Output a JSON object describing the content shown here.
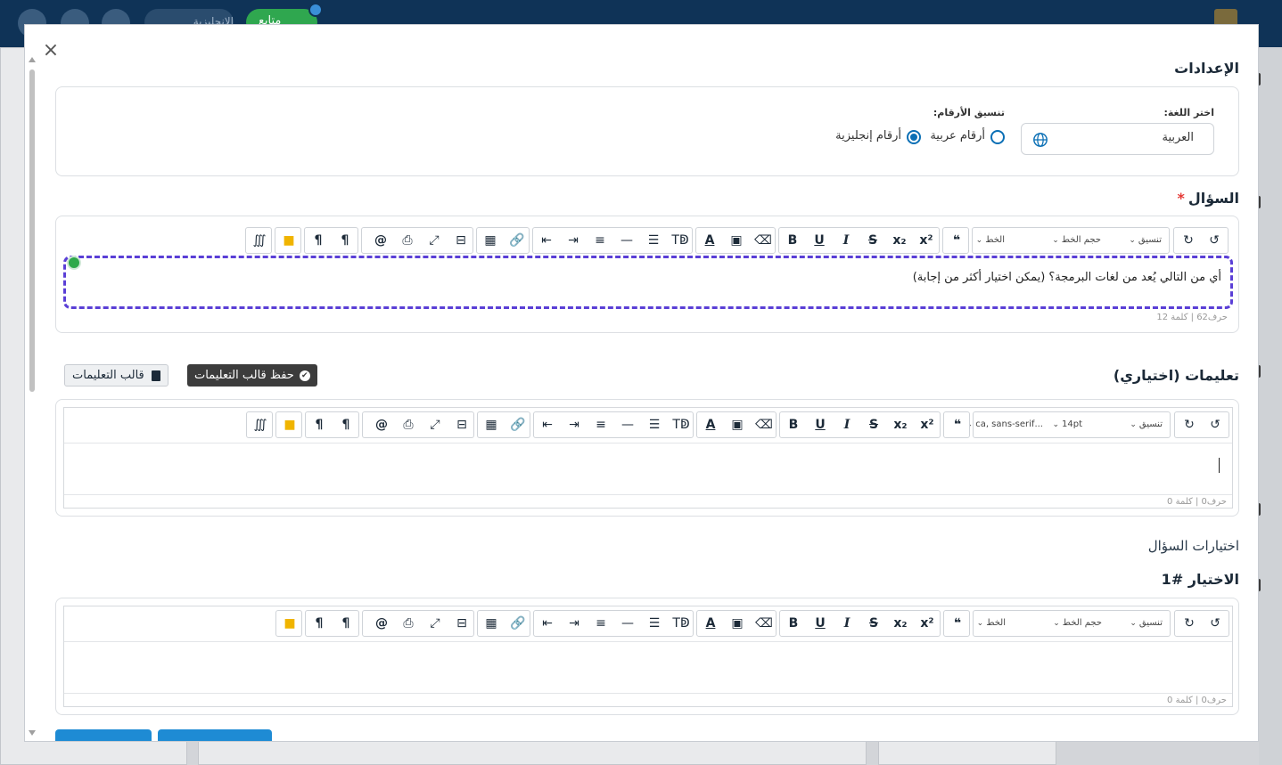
{
  "topbar": {
    "language_pill": "الإنجليزية",
    "status_pill": "متابع"
  },
  "modal": {
    "close_label": "×",
    "settings_title": "الإعدادات",
    "language": {
      "label": "اختر اللغة:",
      "value": "العربية",
      "icon": "globe-icon"
    },
    "number_format": {
      "label": "تنسيق الأرقام:",
      "options": [
        {
          "label": "أرقام عربية",
          "checked": false
        },
        {
          "label": "أرقام إنجليزية",
          "checked": true
        }
      ]
    },
    "question": {
      "title": "السؤال",
      "required_mark": "*",
      "text": "أي من التالي يُعد من لغات البرمجة؟ (يمكن اختيار أكثر من إجابة)",
      "status": "حرف62   |   كلمة 12",
      "toolbar": {
        "format": "تنسيق",
        "font_size": "حجم الخط",
        "font": "الخط"
      }
    },
    "instructions": {
      "title": "تعليمات (اختياري)",
      "save_template_label": "حفظ قالب التعليمات",
      "template_label": "قالب التعليمات",
      "status": "حرف0   |   كلمة 0",
      "toolbar": {
        "format": "تنسيق",
        "font_size": "14pt",
        "font": "...ca, sans-serif"
      }
    },
    "choices": {
      "title": "اختيارات السؤال",
      "choice1_title": "الاختيار #1",
      "status": "حرف0   |   كلمة 0",
      "toolbar": {
        "format": "تنسيق",
        "font_size": "حجم الخط",
        "font": "الخط"
      }
    }
  }
}
